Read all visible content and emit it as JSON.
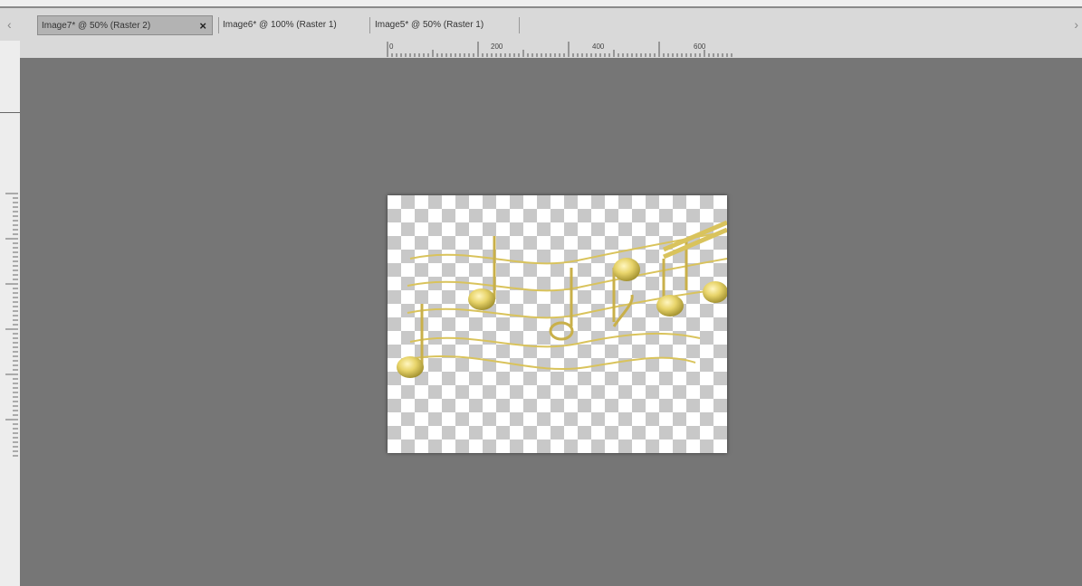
{
  "tabs": [
    {
      "label": "Image7* @  50% (Raster 2)",
      "active": true,
      "close": "×"
    },
    {
      "label": "Image6* @ 100% (Raster 1)",
      "active": false
    },
    {
      "label": "Image5* @  50% (Raster 1)",
      "active": false
    }
  ],
  "nav": {
    "left": "‹",
    "right": "›"
  },
  "ruler": {
    "h_labels": [
      "0",
      "200",
      "400",
      "600"
    ]
  },
  "colors": {
    "workspace": "#767676",
    "chrome": "#d9d9d9",
    "gold": "#e4d26a"
  },
  "icons": {
    "prev": "chevron-left-icon",
    "next": "chevron-right-icon",
    "close": "close-icon"
  }
}
